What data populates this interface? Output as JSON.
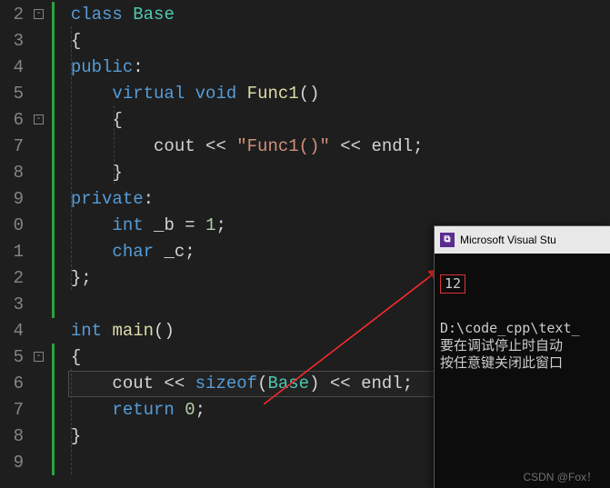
{
  "line_numbers": [
    "2",
    "3",
    "4",
    "5",
    "6",
    "7",
    "8",
    "9",
    "0",
    "1",
    "2",
    "3",
    "4",
    "5",
    "6",
    "7",
    "8",
    "9"
  ],
  "fold_markers": {
    "row0": "-",
    "row4": "-",
    "row13": "-"
  },
  "code": {
    "l0_kw_class": "class",
    "l0_type": "Base",
    "l1_brace": "{",
    "l2_kw": "public",
    "l2_colon": ":",
    "l3_kw_virtual": "virtual",
    "l3_kw_void": "void",
    "l3_fn": "Func1",
    "l3_parens": "()",
    "l4_brace": "{",
    "l5_cout": "cout",
    "l5_op1": " << ",
    "l5_str": "\"Func1()\"",
    "l5_op2": " << ",
    "l5_endl": "endl",
    "l5_semi": ";",
    "l6_brace": "}",
    "l7_kw": "private",
    "l7_colon": ":",
    "l8_kw_int": "int",
    "l8_var": "_b",
    "l8_eq": " = ",
    "l8_num": "1",
    "l8_semi": ";",
    "l9_kw_char": "char",
    "l9_var": "_c",
    "l9_semi": ";",
    "l10_close": "};",
    "l12_kw_int": "int",
    "l12_fn": "main",
    "l12_parens": "()",
    "l13_brace": "{",
    "l14_cout": "cout",
    "l14_op1": " << ",
    "l14_kw_sizeof": "sizeof",
    "l14_paren_o": "(",
    "l14_type": "Base",
    "l14_paren_c": ")",
    "l14_op2": " << ",
    "l14_endl": "endl",
    "l14_semi": ";",
    "l15_kw_return": "return",
    "l15_sp": " ",
    "l15_num": "0",
    "l15_semi": ";",
    "l16_brace": "}"
  },
  "console": {
    "title": "Microsoft Visual Stu",
    "output_value": "12",
    "path_line": "D:\\code_cpp\\text_",
    "msg1": "要在调试停止时自动",
    "msg2": "按任意键关闭此窗口"
  },
  "watermark": "CSDN @Fox！"
}
